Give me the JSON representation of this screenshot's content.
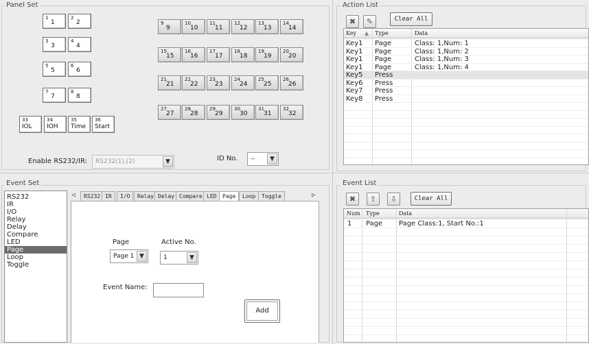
{
  "panel_set": {
    "title": "Panel Set",
    "left_keys": [
      {
        "num": "1",
        "label": "1"
      },
      {
        "num": "2",
        "label": "2"
      },
      {
        "num": "3",
        "label": "3"
      },
      {
        "num": "4",
        "label": "4"
      },
      {
        "num": "5",
        "label": "5"
      },
      {
        "num": "6",
        "label": "6"
      },
      {
        "num": "7",
        "label": "7"
      },
      {
        "num": "8",
        "label": "8"
      }
    ],
    "right_keys": [
      {
        "num": "9",
        "label": "9"
      },
      {
        "num": "10",
        "label": "10"
      },
      {
        "num": "11",
        "label": "11"
      },
      {
        "num": "12",
        "label": "12"
      },
      {
        "num": "13",
        "label": "13"
      },
      {
        "num": "14",
        "label": "14"
      },
      {
        "num": "15",
        "label": "15"
      },
      {
        "num": "16",
        "label": "16"
      },
      {
        "num": "17",
        "label": "17"
      },
      {
        "num": "18",
        "label": "18"
      },
      {
        "num": "19",
        "label": "19"
      },
      {
        "num": "20",
        "label": "20"
      },
      {
        "num": "21",
        "label": "21"
      },
      {
        "num": "22",
        "label": "22"
      },
      {
        "num": "23",
        "label": "23"
      },
      {
        "num": "24",
        "label": "24"
      },
      {
        "num": "25",
        "label": "25"
      },
      {
        "num": "26",
        "label": "26"
      },
      {
        "num": "27",
        "label": "27"
      },
      {
        "num": "28",
        "label": "28"
      },
      {
        "num": "29",
        "label": "29"
      },
      {
        "num": "30",
        "label": "30"
      },
      {
        "num": "31",
        "label": "31"
      },
      {
        "num": "32",
        "label": "32"
      }
    ],
    "bottom_keys": [
      {
        "num": "33",
        "label": "IOL"
      },
      {
        "num": "34",
        "label": "IOH"
      },
      {
        "num": "35",
        "label": "Time"
      },
      {
        "num": "36",
        "label": "Start"
      }
    ],
    "enable_label": "Enable RS232/IR:",
    "enable_value": "RS232(1),(2)",
    "id_label": "ID No.",
    "id_value": "--"
  },
  "action_list": {
    "title": "Action List",
    "clear_label": "Clear All",
    "columns": [
      "Key",
      "Type",
      "Data"
    ],
    "rows": [
      {
        "key": "Key1",
        "type": "Page",
        "data": "Class: 1,Num: 1"
      },
      {
        "key": "Key1",
        "type": "Page",
        "data": "Class: 1,Num: 2"
      },
      {
        "key": "Key1",
        "type": "Page",
        "data": "Class: 1,Num: 3"
      },
      {
        "key": "Key1",
        "type": "Page",
        "data": "Class: 1,Num: 4"
      },
      {
        "key": "Key5",
        "type": "Press",
        "data": ""
      },
      {
        "key": "Key6",
        "type": "Press",
        "data": ""
      },
      {
        "key": "Key7",
        "type": "Press",
        "data": ""
      },
      {
        "key": "Key8",
        "type": "Press",
        "data": ""
      }
    ]
  },
  "event_set": {
    "title": "Event Set",
    "list": [
      "RS232",
      "IR",
      "I/O",
      "Relay",
      "Delay",
      "Compare",
      "LED",
      "Page",
      "Loop",
      "Toggle"
    ],
    "selected": "Page",
    "tabs": [
      "RS232",
      "IR",
      "I/O",
      "Relay",
      "Delay",
      "Compare",
      "LED",
      "Page",
      "Loop",
      "Toggle"
    ],
    "active_tab": "Page",
    "page_label": "Page",
    "page_value": "Page 1",
    "active_no_label": "Active No.",
    "active_no_value": "1",
    "event_name_label": "Event Name:",
    "event_name_value": "",
    "add_label": "Add"
  },
  "event_list": {
    "title": "Event List",
    "clear_label": "Clear All",
    "columns": [
      "Num",
      "Type",
      "Data"
    ],
    "rows": [
      {
        "num": "1",
        "type": "Page",
        "data": "Page Class:1, Start No.:1"
      }
    ]
  },
  "icons": {
    "delete": "delete-icon",
    "edit": "edit-icon",
    "up": "arrow-up-icon",
    "down": "arrow-down-icon",
    "dropdown": "chevron-down-icon",
    "tab_left": "tab-scroll-left-icon",
    "tab_right": "tab-scroll-right-icon"
  }
}
